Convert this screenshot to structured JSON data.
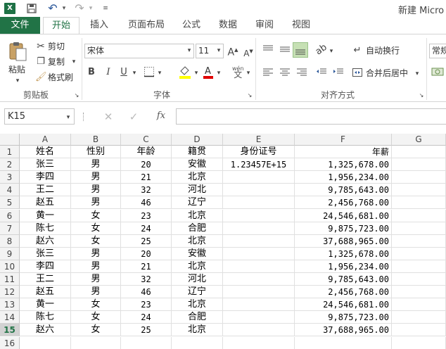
{
  "titlebar": {
    "app_icon": "excel-icon",
    "title": "新建 Micro",
    "undo_glyph": "↶",
    "redo_glyph": "↷"
  },
  "tabs": [
    {
      "label": "文件",
      "kind": "file"
    },
    {
      "label": "开始",
      "active": true
    },
    {
      "label": "插入"
    },
    {
      "label": "页面布局"
    },
    {
      "label": "公式"
    },
    {
      "label": "数据"
    },
    {
      "label": "审阅"
    },
    {
      "label": "视图"
    }
  ],
  "ribbon": {
    "clipboard": {
      "group_label": "剪贴板",
      "paste_label": "粘贴",
      "cut_label": "剪切",
      "copy_label": "复制",
      "format_painter_label": "格式刷"
    },
    "font": {
      "group_label": "字体",
      "font_name": "宋体",
      "font_size": "11",
      "bold": "B",
      "italic": "I",
      "underline": "U",
      "phonetic": "wén"
    },
    "alignment": {
      "group_label": "对齐方式",
      "wrap_label": "自动换行",
      "merge_label": "合并后居中"
    },
    "number": {
      "format_label": "常规"
    }
  },
  "formula_bar": {
    "name_box": "K15",
    "fx": "fx",
    "value": ""
  },
  "sheet": {
    "columns": [
      "A",
      "B",
      "C",
      "D",
      "E",
      "F",
      "G"
    ],
    "selected_row": 15,
    "rows": [
      {
        "n": "1",
        "cells": [
          "姓名",
          "性别",
          "年龄",
          "籍贯",
          "身份证号",
          "年薪"
        ]
      },
      {
        "n": "2",
        "cells": [
          "张三",
          "男",
          "20",
          "安徽",
          "1.23457E+15",
          "1,325,678.00"
        ]
      },
      {
        "n": "3",
        "cells": [
          "李四",
          "男",
          "21",
          "北京",
          "",
          "1,956,234.00"
        ]
      },
      {
        "n": "4",
        "cells": [
          "王二",
          "男",
          "32",
          "河北",
          "",
          "9,785,643.00"
        ]
      },
      {
        "n": "5",
        "cells": [
          "赵五",
          "男",
          "46",
          "辽宁",
          "",
          "2,456,768.00"
        ]
      },
      {
        "n": "6",
        "cells": [
          "黄一",
          "女",
          "23",
          "北京",
          "",
          "24,546,681.00"
        ]
      },
      {
        "n": "7",
        "cells": [
          "陈七",
          "女",
          "24",
          "合肥",
          "",
          "9,875,723.00"
        ]
      },
      {
        "n": "8",
        "cells": [
          "赵六",
          "女",
          "25",
          "北京",
          "",
          "37,688,965.00"
        ]
      },
      {
        "n": "9",
        "cells": [
          "张三",
          "男",
          "20",
          "安徽",
          "",
          "1,325,678.00"
        ]
      },
      {
        "n": "10",
        "cells": [
          "李四",
          "男",
          "21",
          "北京",
          "",
          "1,956,234.00"
        ]
      },
      {
        "n": "11",
        "cells": [
          "王二",
          "男",
          "32",
          "河北",
          "",
          "9,785,643.00"
        ]
      },
      {
        "n": "12",
        "cells": [
          "赵五",
          "男",
          "46",
          "辽宁",
          "",
          "2,456,768.00"
        ]
      },
      {
        "n": "13",
        "cells": [
          "黄一",
          "女",
          "23",
          "北京",
          "",
          "24,546,681.00"
        ]
      },
      {
        "n": "14",
        "cells": [
          "陈七",
          "女",
          "24",
          "合肥",
          "",
          "9,875,723.00"
        ]
      },
      {
        "n": "15",
        "cells": [
          "赵六",
          "女",
          "25",
          "北京",
          "",
          "37,688,965.00"
        ]
      },
      {
        "n": "16",
        "cells": [
          "",
          "",
          "",
          "",
          "",
          ""
        ]
      }
    ]
  }
}
